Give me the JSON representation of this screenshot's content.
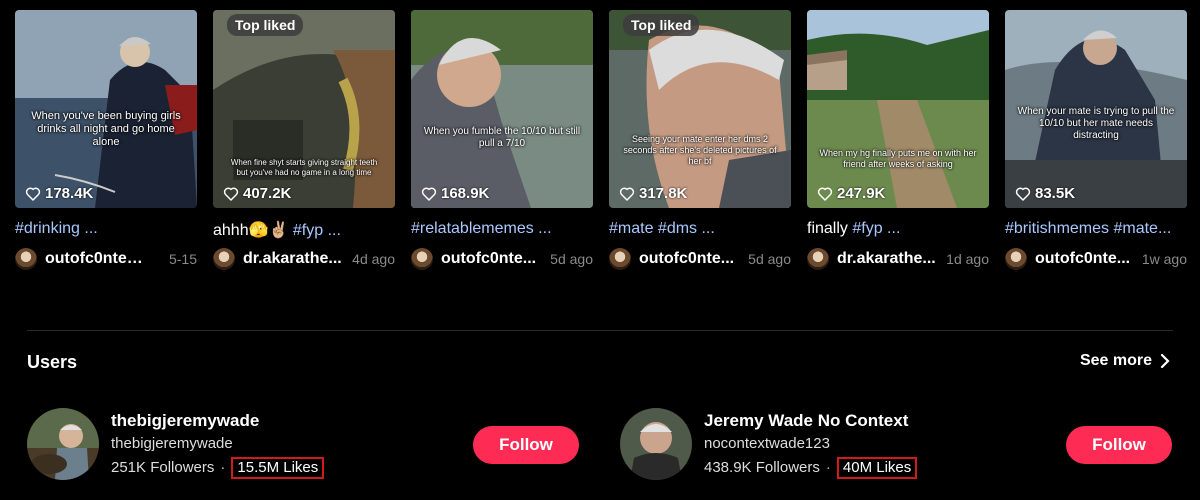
{
  "videos": [
    {
      "caption": "When you've been buying girls drinks all night and go home alone",
      "likes": "178.4K",
      "top_liked": "",
      "desc_text": "",
      "desc_tags": "#drinking ...",
      "user": "outofc0ntext...",
      "date": "5-15"
    },
    {
      "caption": "When fine shyt starts giving straight teeth but you've had no game in a long time",
      "likes": "407.2K",
      "top_liked": "Top liked",
      "desc_text": "ahhh🫣✌🏼 ",
      "desc_tags": "#fyp ...",
      "user": "dr.akarathe...",
      "date": "4d ago"
    },
    {
      "caption": "When you fumble the 10/10 but still pull a 7/10",
      "likes": "168.9K",
      "top_liked": "",
      "desc_text": "",
      "desc_tags": "#relatablememes ...",
      "user": "outofc0nte...",
      "date": "5d ago"
    },
    {
      "caption": "Seeing your mate enter her dms 2 seconds after she's deleted pictures of her bf",
      "likes": "317.8K",
      "top_liked": "Top liked",
      "desc_text": "",
      "desc_tags": "#mate #dms ...",
      "user": "outofc0nte...",
      "date": "5d ago"
    },
    {
      "caption": "When my hg finally puts me on with her friend after weeks of asking",
      "likes": "247.9K",
      "top_liked": "",
      "desc_text": "finally ",
      "desc_tags": "#fyp ...",
      "user": "dr.akarathe...",
      "date": "1d ago"
    },
    {
      "caption": "When your mate is trying to pull the 10/10 but her mate needs distracting",
      "likes": "83.5K",
      "top_liked": "",
      "desc_text": "",
      "desc_tags": "#britishmemes #mate...",
      "user": "outofc0nte...",
      "date": "1w ago"
    }
  ],
  "users_section": {
    "title": "Users",
    "see_more": "See more"
  },
  "users": [
    {
      "name": "thebigjeremywade",
      "handle": "thebigjeremywade",
      "followers": "251K Followers",
      "likes": "15.5M Likes",
      "follow_label": "Follow"
    },
    {
      "name": "Jeremy Wade No Context",
      "handle": "nocontextwade123",
      "followers": "438.9K Followers",
      "likes": "40M Likes",
      "follow_label": "Follow"
    }
  ],
  "colors": {
    "accent": "#fe2c55",
    "highlight_box": "#d11b1b",
    "hashtag": "#a9c8ff"
  },
  "icons": [
    "heart-outline-icon",
    "chevron-right-icon"
  ]
}
